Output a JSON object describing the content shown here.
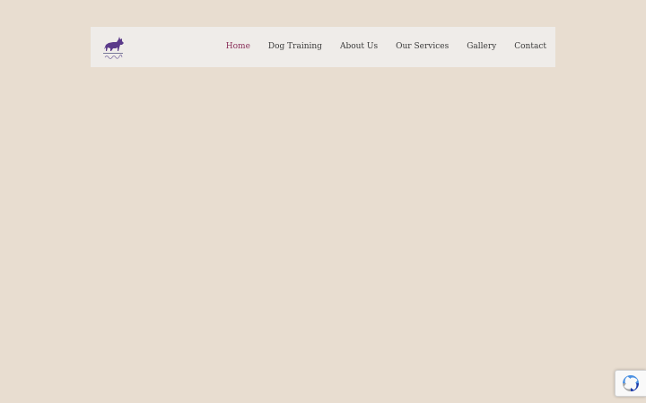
{
  "logo": {
    "icon": "wolf-logo-icon",
    "accent_color": "#5b3a8a"
  },
  "nav": {
    "items": [
      {
        "label": "Home",
        "active": true
      },
      {
        "label": "Dog Training",
        "active": false
      },
      {
        "label": "About Us",
        "active": false
      },
      {
        "label": "Our Services",
        "active": false
      },
      {
        "label": "Gallery",
        "active": false
      },
      {
        "label": "Contact",
        "active": false
      }
    ],
    "active_color": "#8a2f5a",
    "text_color": "#3b3b3b"
  },
  "recaptcha": {
    "icon": "recaptcha-icon"
  },
  "colors": {
    "background": "#e8ddd0",
    "header_background": "#efece9"
  }
}
